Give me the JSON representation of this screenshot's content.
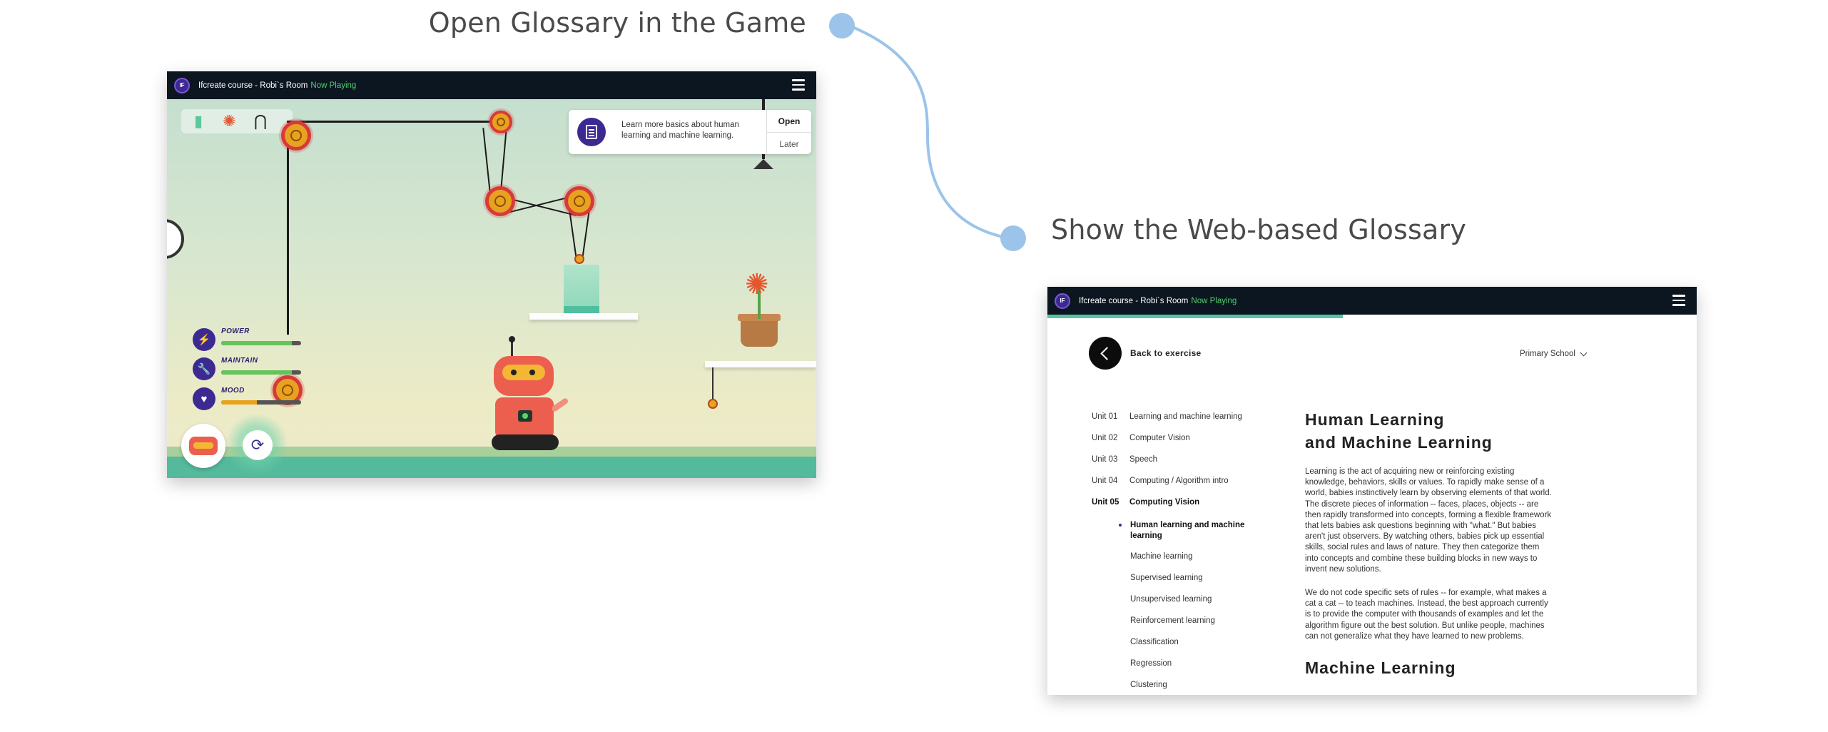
{
  "captions": {
    "left": "Open Glossary in the Game",
    "right": "Show the Web-based Glossary"
  },
  "game": {
    "window": {
      "logo": "IF",
      "title": "Ifcreate course - Robi`s Room",
      "status": "Now Playing",
      "menu_icon": "hamburger-icon"
    },
    "notification": {
      "icon": "document-icon",
      "text": "Learn more basics about human learning and machine learning.",
      "open_label": "Open",
      "later_label": "Later"
    },
    "tools": [
      "glass-tool-icon",
      "flower-tool-icon",
      "grabber-tool-icon"
    ],
    "stats": [
      {
        "label": "POWER",
        "icon": "lightning-icon",
        "glyph": "⚡",
        "level": 0.88
      },
      {
        "label": "MAINTAIN",
        "icon": "wrench-icon",
        "glyph": "🔧",
        "level": 0.88
      },
      {
        "label": "MOOD",
        "icon": "heart-icon",
        "glyph": "♥",
        "level": 0.45
      }
    ],
    "colors": {
      "accent": "#3c2a92",
      "bar_fill": "#65c35d",
      "robot": "#ec5e4e",
      "now_playing": "#4fcf6a"
    }
  },
  "glossary": {
    "window": {
      "logo": "IF",
      "title": "Ifcreate course - Robi`s Room",
      "status": "Now Playing",
      "menu_icon": "hamburger-icon"
    },
    "progress": 0.455,
    "back_label": "Back to exercise",
    "level_select": "Primary School",
    "units": [
      {
        "unit": "Unit 01",
        "label": "Learning and machine learning"
      },
      {
        "unit": "Unit 02",
        "label": "Computer Vision"
      },
      {
        "unit": "Unit 03",
        "label": "Speech"
      },
      {
        "unit": "Unit 04",
        "label": "Computing / Algorithm intro"
      },
      {
        "unit": "Unit 05",
        "label": "Computing Vision",
        "active": true
      }
    ],
    "subitems": [
      "Human learning and machine learning",
      "Machine learning",
      "Supervised learning",
      "Unsupervised learning",
      "Reinforcement learning",
      "Classification",
      "Regression",
      "Clustering"
    ],
    "article": {
      "title": "Human Learning\nand Machine Learning",
      "paragraphs": [
        "Learning is the act of acquiring new or reinforcing existing knowledge, behaviors, skills or values. To rapidly make sense of a world, babies instinctively learn by observing elements of that world. The discrete pieces of information -- faces, places, objects -- are then rapidly transformed into concepts, forming a flexible framework that lets babies ask questions beginning with \"what.\" But babies aren't just observers. By watching others, babies pick up essential skills, social rules and laws of nature. They then categorize them into concepts and combine these building blocks in new ways to invent new solutions.",
        "We do not code specific sets of rules -- for example, what makes a cat a cat -- to teach machines. Instead, the best approach currently is to provide the computer with thousands of examples and let the algorithm figure out the best solution. But unlike people, machines can not generalize what they have learned to new problems."
      ],
      "next_heading": "Machine Learning"
    }
  }
}
